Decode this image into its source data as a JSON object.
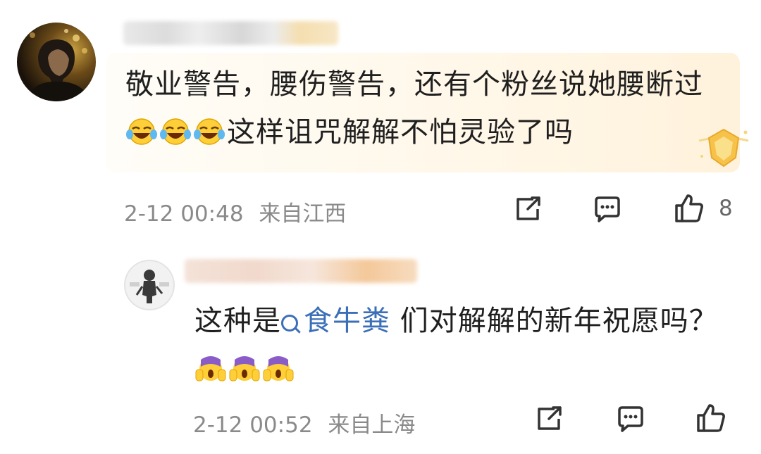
{
  "comments": [
    {
      "text_part1": "敬业警告，腰伤警告，还有个粉丝说她腰断过",
      "emojis": [
        "laugh-cry-emoji",
        "laugh-cry-emoji",
        "laugh-cry-emoji"
      ],
      "text_part2": "这样诅咒解解不怕灵验了吗",
      "timestamp": "2-12 00:48",
      "location": "来自江西",
      "like_count": "8",
      "badge_icon": "gold-shield-badge"
    },
    {
      "text_before": "这种是",
      "topic": "食牛粪",
      "text_after": " 们对解解的新年祝愿吗？",
      "emojis": [
        "fearful-face-emoji",
        "fearful-face-emoji",
        "fearful-face-emoji"
      ],
      "timestamp": "2-12 00:52",
      "location": "来自上海"
    }
  ],
  "colors": {
    "link": "#3b6fb8",
    "meta": "#8a8a8a",
    "bubble": "#fff7e8"
  }
}
